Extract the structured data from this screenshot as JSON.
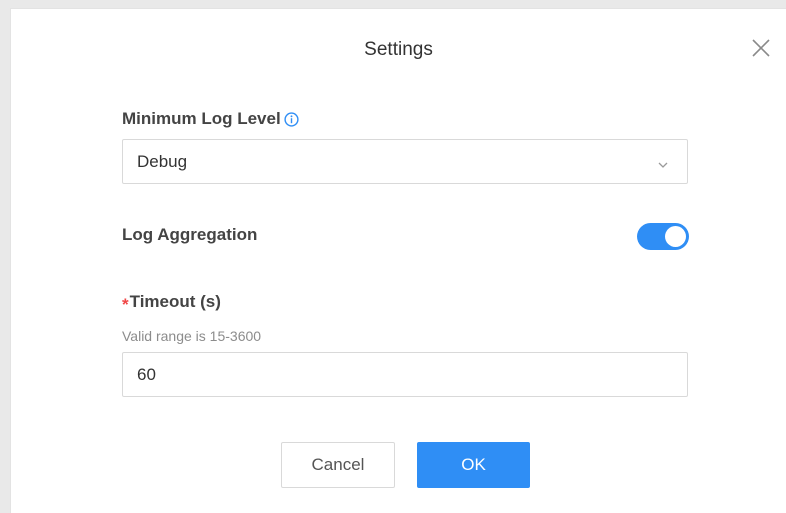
{
  "dialog": {
    "title": "Settings",
    "close_icon": "close-icon"
  },
  "min_log_level": {
    "label": "Minimum Log Level",
    "info_icon": "info-icon",
    "selected": "Debug",
    "chevron_icon": "chevron-down-icon"
  },
  "log_aggregation": {
    "label": "Log Aggregation",
    "enabled": true
  },
  "timeout": {
    "required_mark": "*",
    "label": "Timeout (s)",
    "hint": "Valid range is 15-3600",
    "value": "60"
  },
  "buttons": {
    "cancel": "Cancel",
    "ok": "OK"
  },
  "colors": {
    "accent": "#2f8ef5",
    "required": "#f04646"
  }
}
